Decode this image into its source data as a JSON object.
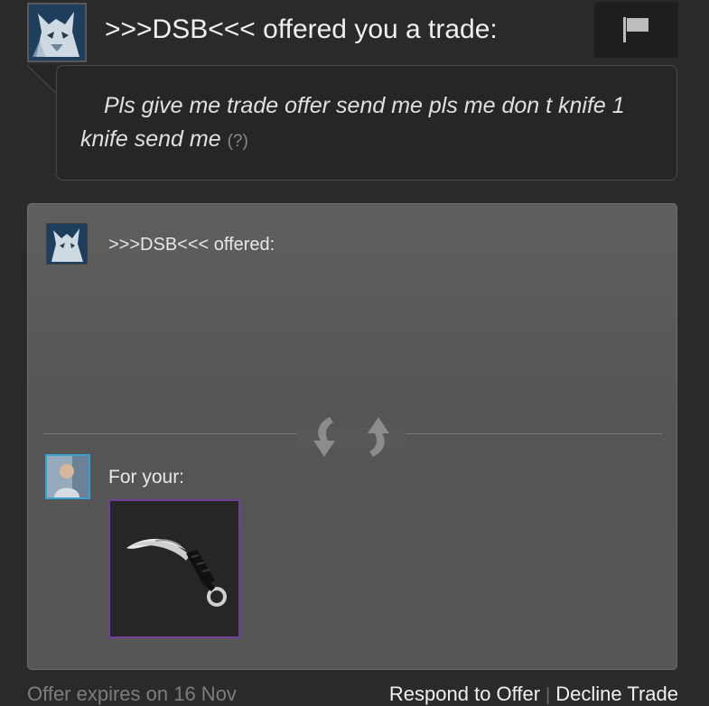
{
  "header": {
    "title": ">>>DSB<<< offered you a trade:",
    "flag_icon": "flag-icon"
  },
  "message": {
    "text": "Pls give me trade offer send me pls me don t knife 1 knife send me",
    "help": "(?)"
  },
  "panel": {
    "them_label": ">>>DSB<<< offered:",
    "you_label": "For your:",
    "swap_icon": "trade-swap-arrows-icon",
    "item_icon": "karambit-knife-icon",
    "item_border_color": "#6e3f9e"
  },
  "footer": {
    "expires": "Offer expires on 16 Nov",
    "respond": "Respond to Offer",
    "separator": "|",
    "decline": "Decline Trade"
  },
  "colors": {
    "background": "#2a2a2a",
    "avatar_border_you": "#3aa0cf"
  }
}
